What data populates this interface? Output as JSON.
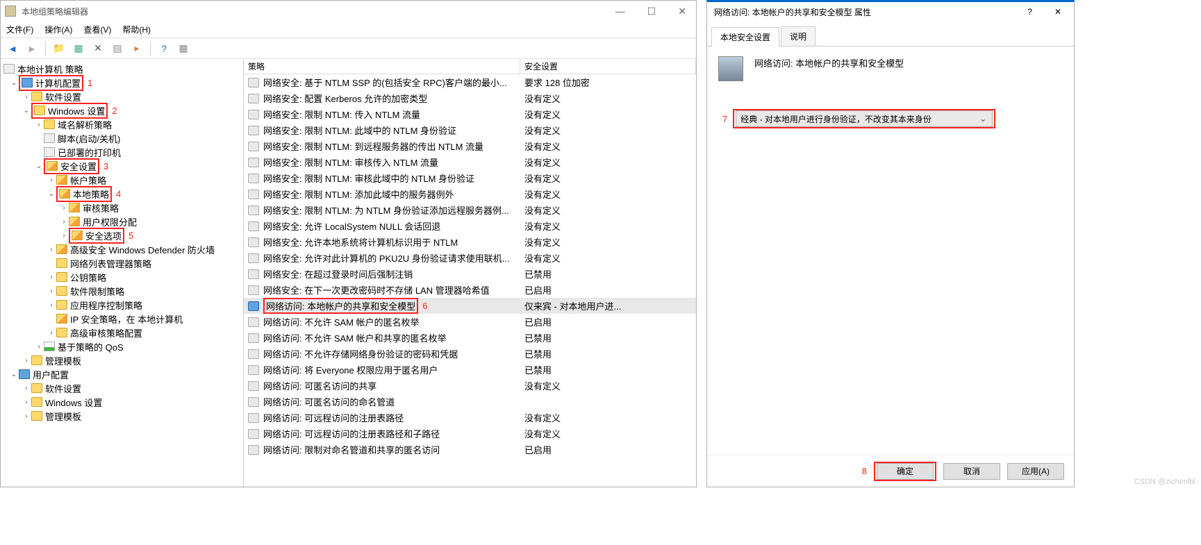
{
  "win1": {
    "title": "本地组策略编辑器",
    "menus": [
      "文件(F)",
      "操作(A)",
      "查看(V)",
      "帮助(H)"
    ],
    "root": "本地计算机 策略",
    "tree": {
      "computer_config": "计算机配置",
      "software_settings": "软件设置",
      "windows_settings": "Windows 设置",
      "dns_policy": "域名解析策略",
      "scripts": "脚本(启动/关机)",
      "deployed_printers": "已部署的打印机",
      "security_settings": "安全设置",
      "account_policy": "帐户策略",
      "local_policy": "本地策略",
      "audit_policy": "审核策略",
      "user_rights": "用户权限分配",
      "security_options": "安全选项",
      "defender": "高级安全 Windows Defender 防火墙",
      "network_list": "网络列表管理器策略",
      "public_key": "公钥策略",
      "software_restrict": "软件限制策略",
      "app_control": "应用程序控制策略",
      "ip_security": "IP 安全策略，在 本地计算机",
      "advanced_audit": "高级审核策略配置",
      "qos": "基于策略的 QoS",
      "admin_templates1": "管理模板",
      "user_config": "用户配置",
      "software_settings2": "软件设置",
      "windows_settings2": "Windows 设置",
      "admin_templates2": "管理模板"
    },
    "annot": {
      "1": "1",
      "2": "2",
      "3": "3",
      "4": "4",
      "5": "5",
      "6": "6"
    },
    "list": {
      "h1": "策略",
      "h2": "安全设置",
      "rows": [
        {
          "n": "网络安全: 基于 NTLM SSP 的(包括安全 RPC)客户端的最小...",
          "v": "要求 128 位加密"
        },
        {
          "n": "网络安全: 配置 Kerberos 允许的加密类型",
          "v": "没有定义"
        },
        {
          "n": "网络安全: 限制 NTLM: 传入 NTLM 流量",
          "v": "没有定义"
        },
        {
          "n": "网络安全: 限制 NTLM: 此域中的 NTLM 身份验证",
          "v": "没有定义"
        },
        {
          "n": "网络安全: 限制 NTLM: 到远程服务器的传出 NTLM 流量",
          "v": "没有定义"
        },
        {
          "n": "网络安全: 限制 NTLM: 审核传入 NTLM 流量",
          "v": "没有定义"
        },
        {
          "n": "网络安全: 限制 NTLM: 审核此域中的 NTLM 身份验证",
          "v": "没有定义"
        },
        {
          "n": "网络安全: 限制 NTLM: 添加此域中的服务器例外",
          "v": "没有定义"
        },
        {
          "n": "网络安全: 限制 NTLM: 为 NTLM 身份验证添加远程服务器例...",
          "v": "没有定义"
        },
        {
          "n": "网络安全: 允许 LocalSystem NULL 会话回退",
          "v": "没有定义"
        },
        {
          "n": "网络安全: 允许本地系统将计算机标识用于 NTLM",
          "v": "没有定义"
        },
        {
          "n": "网络安全: 允许对此计算机的 PKU2U 身份验证请求使用联机...",
          "v": "没有定义"
        },
        {
          "n": "网络安全: 在超过登录时间后强制注销",
          "v": "已禁用"
        },
        {
          "n": "网络安全: 在下一次更改密码时不存储 LAN 管理器哈希值",
          "v": "已启用"
        },
        {
          "n": "网络访问: 本地帐户的共享和安全模型",
          "v": "仅来宾 - 对本地用户进...",
          "sel": true,
          "blue": true
        },
        {
          "n": "网络访问: 不允许 SAM 帐户的匿名枚举",
          "v": "已启用"
        },
        {
          "n": "网络访问: 不允许 SAM 帐户和共享的匿名枚举",
          "v": "已禁用"
        },
        {
          "n": "网络访问: 不允许存储网络身份验证的密码和凭据",
          "v": "已禁用"
        },
        {
          "n": "网络访问: 将 Everyone 权限应用于匿名用户",
          "v": "已禁用"
        },
        {
          "n": "网络访问: 可匿名访问的共享",
          "v": "没有定义"
        },
        {
          "n": "网络访问: 可匿名访问的命名管道",
          "v": ""
        },
        {
          "n": "网络访问: 可远程访问的注册表路径",
          "v": "没有定义"
        },
        {
          "n": "网络访问: 可远程访问的注册表路径和子路径",
          "v": "没有定义"
        },
        {
          "n": "网络访问: 限制对命名管道和共享的匿名访问",
          "v": "已启用"
        }
      ]
    }
  },
  "win2": {
    "title": "网络访问: 本地帐户的共享和安全模型 属性",
    "tabs": [
      "本地安全设置",
      "说明"
    ],
    "heading": "网络访问: 本地帐户的共享和安全模型",
    "combo": "经典 - 对本地用户进行身份验证，不改变其本来身份",
    "annot7": "7",
    "annot8": "8",
    "buttons": {
      "ok": "确定",
      "cancel": "取消",
      "apply": "应用(A)"
    }
  },
  "watermark": "CSDN @zichenlbl"
}
